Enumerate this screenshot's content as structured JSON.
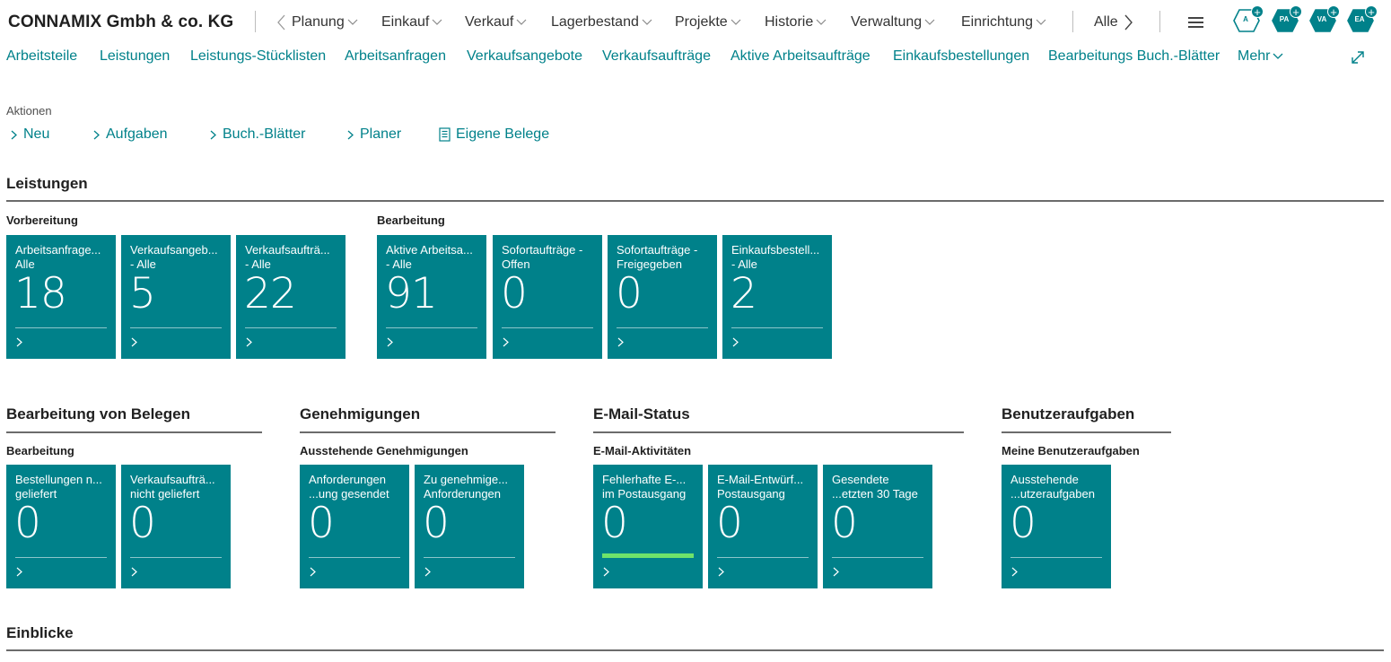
{
  "company": "CONNAMIX Gmbh & co. KG",
  "top_menu": [
    {
      "label": "Planung"
    },
    {
      "label": "Einkauf"
    },
    {
      "label": "Verkauf"
    },
    {
      "label": "Lagerbestand"
    },
    {
      "label": "Projekte"
    },
    {
      "label": "Historie"
    },
    {
      "label": "Verwaltung"
    },
    {
      "label": "Einrichtung"
    }
  ],
  "top_all_label": "Alle",
  "roles": [
    {
      "initials": "A"
    },
    {
      "initials": "PA"
    },
    {
      "initials": "VA"
    },
    {
      "initials": "EA"
    }
  ],
  "nav_links": [
    "Arbeitsteile",
    "Leistungen",
    "Leistungs-Stücklisten",
    "Arbeitsanfragen",
    "Verkaufsangebote",
    "Verkaufsaufträge",
    "Aktive Arbeitsaufträge",
    "Einkaufsbestellungen",
    "Bearbeitungs Buch.-Blätter"
  ],
  "nav_more": "Mehr",
  "actions": {
    "title": "Aktionen",
    "items": [
      {
        "label": "Neu",
        "icon": "chevron-right-icon"
      },
      {
        "label": "Aufgaben",
        "icon": "chevron-right-icon"
      },
      {
        "label": "Buch.-Blätter",
        "icon": "chevron-right-icon"
      },
      {
        "label": "Planer",
        "icon": "chevron-right-icon"
      },
      {
        "label": "Eigene Belege",
        "icon": "document-icon"
      }
    ]
  },
  "colors": {
    "tile": "#00818a",
    "accent": "#00818a",
    "status_ok": "#6fe36a"
  },
  "sections": {
    "leistungen": {
      "title": "Leistungen",
      "groups": [
        {
          "title": "Vorbereitung",
          "tiles": [
            {
              "line1": "Arbeitsanfrage...",
              "line2": "Alle",
              "value": "18"
            },
            {
              "line1": "Verkaufsangeb...",
              "line2": "- Alle",
              "value": "5"
            },
            {
              "line1": "Verkaufsaufträ...",
              "line2": "- Alle",
              "value": "22"
            }
          ]
        },
        {
          "title": "Bearbeitung",
          "tiles": [
            {
              "line1": "Aktive Arbeitsa...",
              "line2": "- Alle",
              "value": "91"
            },
            {
              "line1": "Sofortaufträge -",
              "line2": "Offen",
              "value": "0"
            },
            {
              "line1": "Sofortaufträge -",
              "line2": "Freigegeben",
              "value": "0"
            },
            {
              "line1": "Einkaufsbestell...",
              "line2": "- Alle",
              "value": "2"
            }
          ]
        }
      ]
    },
    "belege": {
      "title": "Bearbeitung von Belegen",
      "group": "Bearbeitung",
      "tiles": [
        {
          "line1": "Bestellungen n...",
          "line2": "geliefert",
          "value": "0"
        },
        {
          "line1": "Verkaufsaufträ...",
          "line2": "nicht geliefert",
          "value": "0"
        }
      ]
    },
    "genehmigungen": {
      "title": "Genehmigungen",
      "group": "Ausstehende Genehmigungen",
      "tiles": [
        {
          "line1": "Anforderungen",
          "line2": "...ung gesendet",
          "value": "0"
        },
        {
          "line1": "Zu genehmige...",
          "line2": "Anforderungen",
          "value": "0"
        }
      ]
    },
    "email": {
      "title": "E-Mail-Status",
      "group": "E-Mail-Aktivitäten",
      "tiles": [
        {
          "line1": "Fehlerhafte E-...",
          "line2": "im Postausgang",
          "value": "0",
          "status": "ok"
        },
        {
          "line1": "E-Mail-Entwürf...",
          "line2": "Postausgang",
          "value": "0"
        },
        {
          "line1": "Gesendete",
          "line2": "...etzten 30 Tage",
          "value": "0"
        }
      ]
    },
    "benutzer": {
      "title": "Benutzeraufgaben",
      "group": "Meine Benutzeraufgaben",
      "tiles": [
        {
          "line1": "Ausstehende",
          "line2": "...utzeraufgaben",
          "value": "0"
        }
      ]
    },
    "einblicke": {
      "title": "Einblicke"
    }
  }
}
